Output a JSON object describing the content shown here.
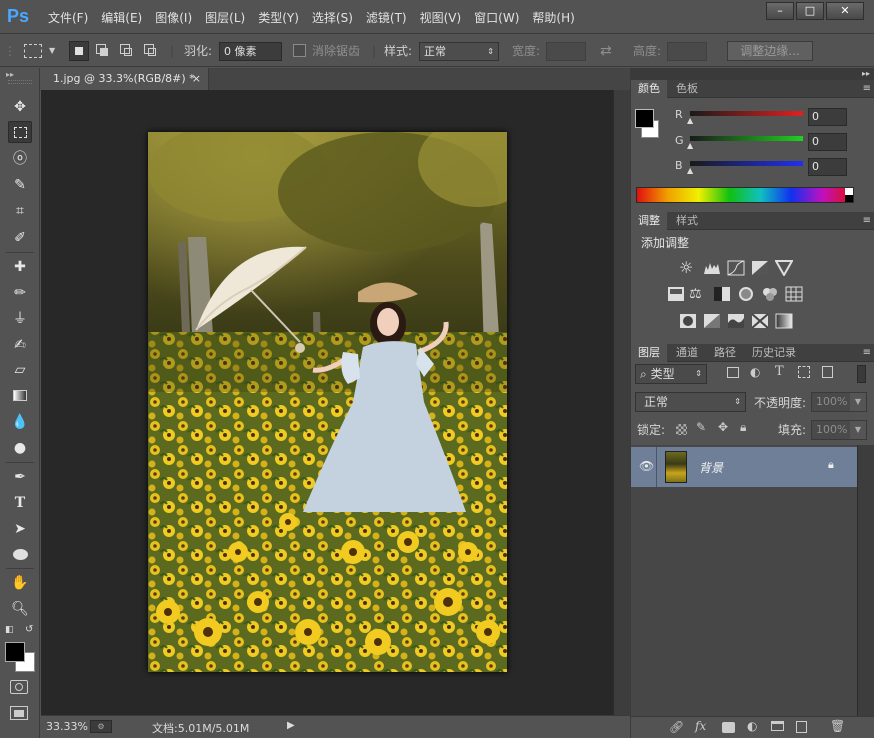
{
  "app": {
    "logo": "Ps"
  },
  "menu": [
    "文件(F)",
    "编辑(E)",
    "图像(I)",
    "图层(L)",
    "类型(Y)",
    "选择(S)",
    "滤镜(T)",
    "视图(V)",
    "窗口(W)",
    "帮助(H)"
  ],
  "window_buttons": {
    "minimize": "–",
    "restore": "□",
    "close": "✕"
  },
  "options": {
    "feather_label": "羽化:",
    "feather_value": "0 像素",
    "antialias_label": "消除锯齿",
    "style_label": "样式:",
    "style_value": "正常",
    "width_label": "宽度:",
    "height_label": "高度:",
    "refine_button": "调整边缘..."
  },
  "document": {
    "tab_title": "1.jpg @ 33.3%(RGB/8#) *",
    "tab_close": "×"
  },
  "status": {
    "zoom": "33.33%",
    "doc_info": "文档:5.01M/5.01M",
    "arrow": "▶"
  },
  "color_panel": {
    "tabs": [
      "颜色",
      "色板"
    ],
    "channels": [
      {
        "label": "R",
        "value": "0",
        "color": "#e02020"
      },
      {
        "label": "G",
        "value": "0",
        "color": "#20c020"
      },
      {
        "label": "B",
        "value": "0",
        "color": "#2030e0"
      }
    ]
  },
  "adjust_panel": {
    "tabs": [
      "调整",
      "样式"
    ],
    "title": "添加调整",
    "row1": [
      "brightness-icon",
      "levels-icon",
      "curves-icon",
      "exposure-icon",
      "gradient-triangle-icon"
    ],
    "row2": [
      "vibrance-icon",
      "balance-icon",
      "black-white-icon",
      "photo-filter-icon",
      "channel-mixer-icon",
      "color-lookup-icon"
    ],
    "row3": [
      "invert-icon",
      "posterize-icon",
      "threshold-icon",
      "selective-color-icon",
      "gradient-map-icon"
    ]
  },
  "layers_panel": {
    "tabs": [
      "图层",
      "通道",
      "路径",
      "历史记录"
    ],
    "filter_label": "类型",
    "blend_mode": "正常",
    "opacity_label": "不透明度:",
    "opacity_value": "100%",
    "lock_label": "锁定:",
    "fill_label": "填充:",
    "fill_value": "100%",
    "layer_name": "背景"
  },
  "panel_menu_glyph": "≡",
  "panel_collapse_glyph": "▸▸",
  "colors": {
    "accent_blue": "#4aa8ff",
    "selected_layer": "#6e7f97"
  }
}
